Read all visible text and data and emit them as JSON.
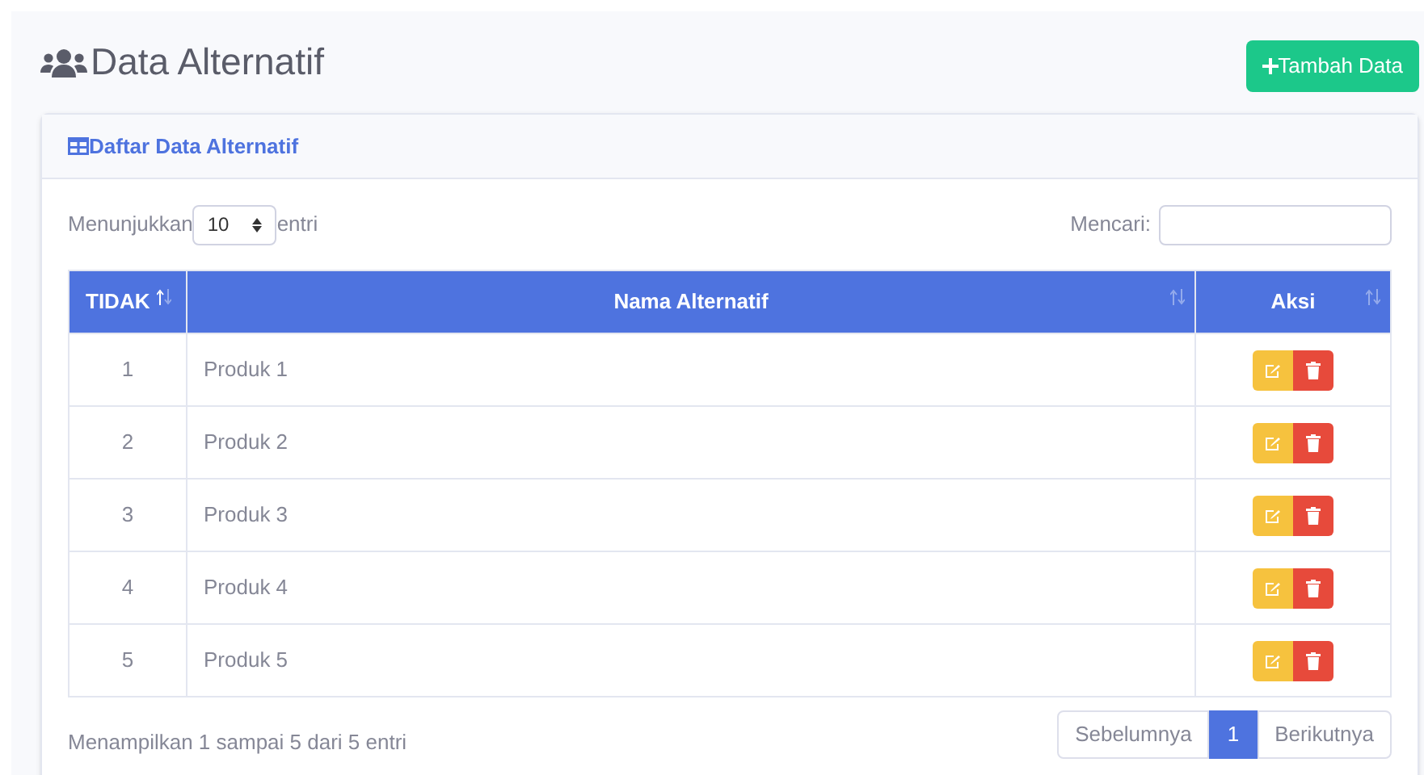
{
  "page_title": "Data Alternatif",
  "add_button": "Tambah Data",
  "card_title": "Daftar Data Alternatif",
  "length_control": {
    "before": "Menunjukkan",
    "value": "10",
    "after": "entri"
  },
  "search": {
    "label": "Mencari:"
  },
  "table": {
    "columns": [
      {
        "label": "TIDAK",
        "sorted_ascending": true
      },
      {
        "label": "Nama Alternatif",
        "sorted_ascending": false
      },
      {
        "label": "Aksi",
        "sorted_ascending": false
      }
    ],
    "rows": [
      {
        "no": "1",
        "name": "Produk 1"
      },
      {
        "no": "2",
        "name": "Produk 2"
      },
      {
        "no": "3",
        "name": "Produk 3"
      },
      {
        "no": "4",
        "name": "Produk 4"
      },
      {
        "no": "5",
        "name": "Produk 5"
      }
    ]
  },
  "info": "Menampilkan 1 sampai 5 dari 5 entri",
  "pagination": [
    {
      "label": "Sebelumnya",
      "selected": false
    },
    {
      "label": "1",
      "selected": true
    },
    {
      "label": "Berikutnya",
      "selected": false
    }
  ]
}
